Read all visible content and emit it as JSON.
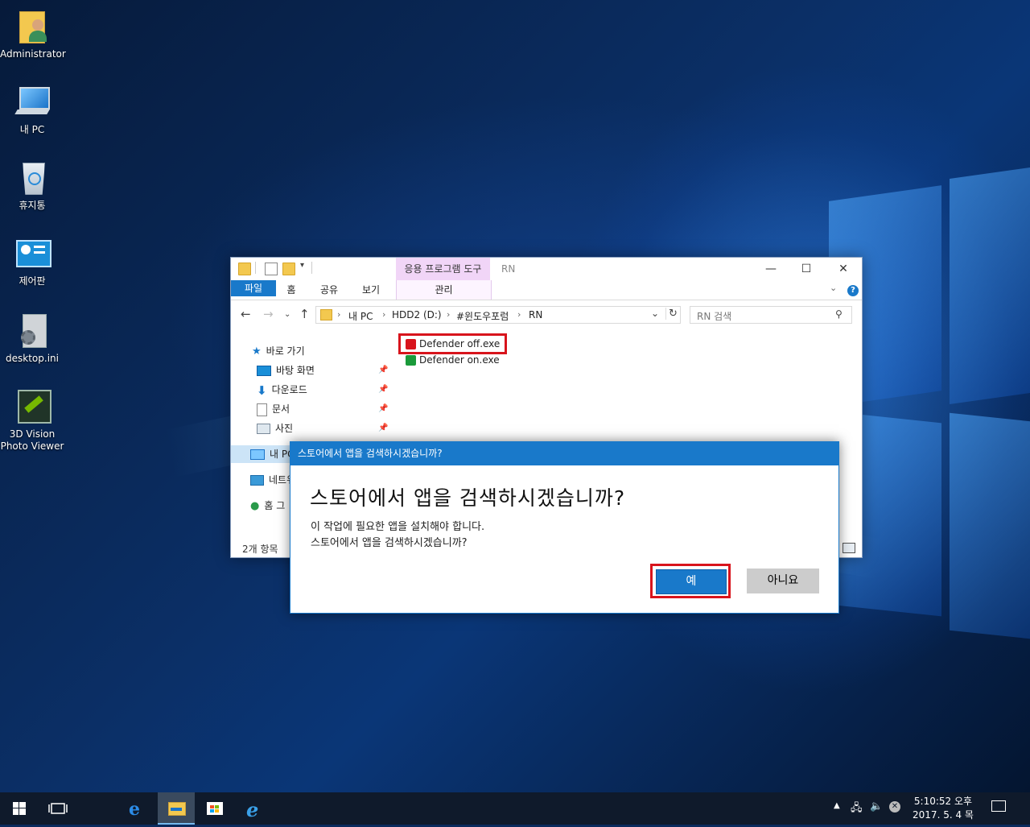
{
  "desktop": {
    "icons": [
      {
        "label": "Administrator"
      },
      {
        "label": "내 PC"
      },
      {
        "label": "휴지통"
      },
      {
        "label": "제어판"
      },
      {
        "label": "desktop.ini"
      },
      {
        "label_line1": "3D Vision",
        "label_line2": "Photo Viewer"
      }
    ]
  },
  "explorer": {
    "context_tab_group": "응용 프로그램 도구",
    "window_title": "RN",
    "ribbon_tabs": [
      "파일",
      "홈",
      "공유",
      "보기"
    ],
    "context_sub_tab": "관리",
    "address": {
      "crumbs": [
        "내 PC",
        "HDD2 (D:)",
        "#윈도우포럼",
        "RN"
      ]
    },
    "search_placeholder": "RN 검색",
    "nav": {
      "quick_access": "바로 가기",
      "items": [
        "바탕 화면",
        "다운로드",
        "문서",
        "사진"
      ],
      "this_pc": "내 PC",
      "network": "네트워",
      "homegroup": "홈 그"
    },
    "files": [
      {
        "name": "Defender off.exe",
        "selected": true,
        "icon": "red-shield-icon"
      },
      {
        "name": "Defender on.exe",
        "selected": false,
        "icon": "green-shield-icon"
      }
    ],
    "status": "2개 항목"
  },
  "dialog": {
    "title": "스토어에서 앱을 검색하시겠습니까?",
    "heading": "스토어에서 앱을 검색하시겠습니까?",
    "line1": "이 작업에 필요한 앱을 설치해야 합니다.",
    "line2": "스토어에서 앱을 검색하시겠습니까?",
    "yes": "예",
    "no": "아니요"
  },
  "taskbar": {
    "time": "5:10:52 오후",
    "date": "2017. 5. 4 목"
  },
  "colors": {
    "accent": "#1979ca",
    "highlight": "#d8141c"
  }
}
